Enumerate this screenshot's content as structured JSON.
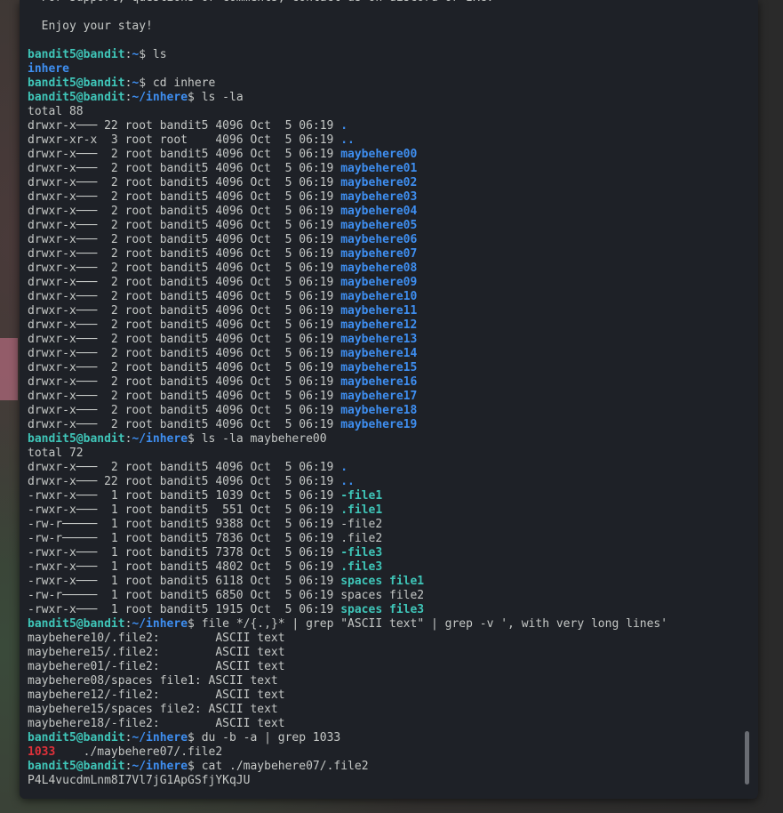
{
  "prompt": {
    "user": "bandit5@bandit",
    "sep": ":",
    "tail": "$ "
  },
  "lines": [
    {
      "kind": "text",
      "text": "  For support, questions or comments, contact us on discord or IRC."
    },
    {
      "kind": "text",
      "text": ""
    },
    {
      "kind": "text",
      "text": "  Enjoy your stay!"
    },
    {
      "kind": "text",
      "text": ""
    },
    {
      "kind": "cmd",
      "path": "~",
      "cmd": "ls"
    },
    {
      "kind": "dironly",
      "text": "inhere"
    },
    {
      "kind": "cmd",
      "path": "~",
      "cmd": "cd inhere"
    },
    {
      "kind": "cmd",
      "path": "~/inhere",
      "cmd": "ls -la"
    },
    {
      "kind": "text",
      "text": "total 88"
    },
    {
      "kind": "ls",
      "meta": "drwxr-x─── 22 root bandit5 4096 Oct  5 06:19 ",
      "name": ".",
      "style": "dir"
    },
    {
      "kind": "ls",
      "meta": "drwxr-xr-x  3 root root    4096 Oct  5 06:19 ",
      "name": "..",
      "style": "dir"
    },
    {
      "kind": "ls",
      "meta": "drwxr-x───  2 root bandit5 4096 Oct  5 06:19 ",
      "name": "maybehere00",
      "style": "dir"
    },
    {
      "kind": "ls",
      "meta": "drwxr-x───  2 root bandit5 4096 Oct  5 06:19 ",
      "name": "maybehere01",
      "style": "dir"
    },
    {
      "kind": "ls",
      "meta": "drwxr-x───  2 root bandit5 4096 Oct  5 06:19 ",
      "name": "maybehere02",
      "style": "dir"
    },
    {
      "kind": "ls",
      "meta": "drwxr-x───  2 root bandit5 4096 Oct  5 06:19 ",
      "name": "maybehere03",
      "style": "dir"
    },
    {
      "kind": "ls",
      "meta": "drwxr-x───  2 root bandit5 4096 Oct  5 06:19 ",
      "name": "maybehere04",
      "style": "dir"
    },
    {
      "kind": "ls",
      "meta": "drwxr-x───  2 root bandit5 4096 Oct  5 06:19 ",
      "name": "maybehere05",
      "style": "dir"
    },
    {
      "kind": "ls",
      "meta": "drwxr-x───  2 root bandit5 4096 Oct  5 06:19 ",
      "name": "maybehere06",
      "style": "dir"
    },
    {
      "kind": "ls",
      "meta": "drwxr-x───  2 root bandit5 4096 Oct  5 06:19 ",
      "name": "maybehere07",
      "style": "dir"
    },
    {
      "kind": "ls",
      "meta": "drwxr-x───  2 root bandit5 4096 Oct  5 06:19 ",
      "name": "maybehere08",
      "style": "dir"
    },
    {
      "kind": "ls",
      "meta": "drwxr-x───  2 root bandit5 4096 Oct  5 06:19 ",
      "name": "maybehere09",
      "style": "dir"
    },
    {
      "kind": "ls",
      "meta": "drwxr-x───  2 root bandit5 4096 Oct  5 06:19 ",
      "name": "maybehere10",
      "style": "dir"
    },
    {
      "kind": "ls",
      "meta": "drwxr-x───  2 root bandit5 4096 Oct  5 06:19 ",
      "name": "maybehere11",
      "style": "dir"
    },
    {
      "kind": "ls",
      "meta": "drwxr-x───  2 root bandit5 4096 Oct  5 06:19 ",
      "name": "maybehere12",
      "style": "dir"
    },
    {
      "kind": "ls",
      "meta": "drwxr-x───  2 root bandit5 4096 Oct  5 06:19 ",
      "name": "maybehere13",
      "style": "dir"
    },
    {
      "kind": "ls",
      "meta": "drwxr-x───  2 root bandit5 4096 Oct  5 06:19 ",
      "name": "maybehere14",
      "style": "dir"
    },
    {
      "kind": "ls",
      "meta": "drwxr-x───  2 root bandit5 4096 Oct  5 06:19 ",
      "name": "maybehere15",
      "style": "dir"
    },
    {
      "kind": "ls",
      "meta": "drwxr-x───  2 root bandit5 4096 Oct  5 06:19 ",
      "name": "maybehere16",
      "style": "dir"
    },
    {
      "kind": "ls",
      "meta": "drwxr-x───  2 root bandit5 4096 Oct  5 06:19 ",
      "name": "maybehere17",
      "style": "dir"
    },
    {
      "kind": "ls",
      "meta": "drwxr-x───  2 root bandit5 4096 Oct  5 06:19 ",
      "name": "maybehere18",
      "style": "dir"
    },
    {
      "kind": "ls",
      "meta": "drwxr-x───  2 root bandit5 4096 Oct  5 06:19 ",
      "name": "maybehere19",
      "style": "dir"
    },
    {
      "kind": "cmd",
      "path": "~/inhere",
      "cmd": "ls -la maybehere00"
    },
    {
      "kind": "text",
      "text": "total 72"
    },
    {
      "kind": "ls",
      "meta": "drwxr-x───  2 root bandit5 4096 Oct  5 06:19 ",
      "name": ".",
      "style": "dir"
    },
    {
      "kind": "ls",
      "meta": "drwxr-x─── 22 root bandit5 4096 Oct  5 06:19 ",
      "name": "..",
      "style": "dir"
    },
    {
      "kind": "ls",
      "meta": "-rwxr-x───  1 root bandit5 1039 Oct  5 06:19 ",
      "name": "-file1",
      "style": "exec"
    },
    {
      "kind": "ls",
      "meta": "-rwxr-x───  1 root bandit5  551 Oct  5 06:19 ",
      "name": ".file1",
      "style": "exec"
    },
    {
      "kind": "ls",
      "meta": "-rw-r─────  1 root bandit5 9388 Oct  5 06:19 ",
      "name": "-file2",
      "style": "plain"
    },
    {
      "kind": "ls",
      "meta": "-rw-r─────  1 root bandit5 7836 Oct  5 06:19 ",
      "name": ".file2",
      "style": "plain"
    },
    {
      "kind": "ls",
      "meta": "-rwxr-x───  1 root bandit5 7378 Oct  5 06:19 ",
      "name": "-file3",
      "style": "exec"
    },
    {
      "kind": "ls",
      "meta": "-rwxr-x───  1 root bandit5 4802 Oct  5 06:19 ",
      "name": ".file3",
      "style": "exec"
    },
    {
      "kind": "ls",
      "meta": "-rwxr-x───  1 root bandit5 6118 Oct  5 06:19 ",
      "name": "spaces file1",
      "style": "exec"
    },
    {
      "kind": "ls",
      "meta": "-rw-r─────  1 root bandit5 6850 Oct  5 06:19 ",
      "name": "spaces file2",
      "style": "plain"
    },
    {
      "kind": "ls",
      "meta": "-rwxr-x───  1 root bandit5 1915 Oct  5 06:19 ",
      "name": "spaces file3",
      "style": "exec"
    },
    {
      "kind": "cmd",
      "path": "~/inhere",
      "cmd": "file */{.,}* | grep \"ASCII text\" | grep -v ', with very long lines'"
    },
    {
      "kind": "text",
      "text": "maybehere10/.file2:        ASCII text"
    },
    {
      "kind": "text",
      "text": "maybehere15/.file2:        ASCII text"
    },
    {
      "kind": "text",
      "text": "maybehere01/-file2:        ASCII text"
    },
    {
      "kind": "text",
      "text": "maybehere08/spaces file1: ASCII text"
    },
    {
      "kind": "text",
      "text": "maybehere12/-file2:        ASCII text"
    },
    {
      "kind": "text",
      "text": "maybehere15/spaces file2: ASCII text"
    },
    {
      "kind": "text",
      "text": "maybehere18/-file2:        ASCII text"
    },
    {
      "kind": "cmd",
      "path": "~/inhere",
      "cmd": "du -b -a | grep 1033"
    },
    {
      "kind": "grep",
      "match": "1033",
      "rest": "\t./maybehere07/.file2"
    },
    {
      "kind": "cmd",
      "path": "~/inhere",
      "cmd": "cat ./maybehere07/.file2"
    },
    {
      "kind": "text",
      "text": "P4L4vucdmLnm8I7Vl7jG1ApGSfjYKqJU"
    }
  ]
}
